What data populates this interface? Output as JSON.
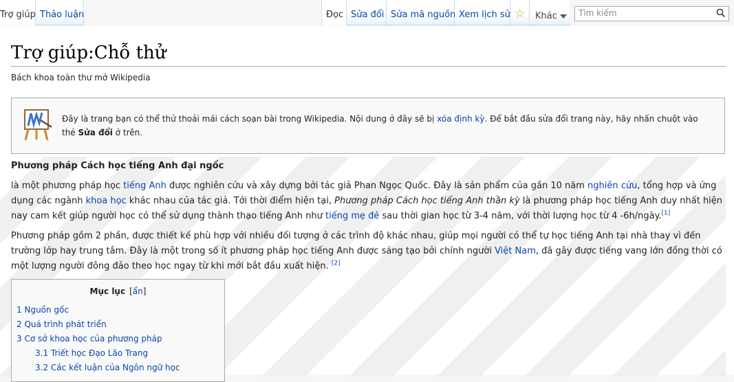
{
  "tabs": {
    "help": "Trợ giúp",
    "talk": "Thảo luận",
    "read": "Đọc",
    "edit": "Sửa đổi",
    "edit_source": "Sửa mã nguồn",
    "history": "Xem lịch sử",
    "more": "Khác"
  },
  "search": {
    "placeholder": "Tìm kiếm"
  },
  "page": {
    "title": "Trợ giúp:Chỗ thử",
    "subtitle": "Bách khoa toàn thư mở Wikipedia"
  },
  "notice": {
    "text_before": "Đây là trang bạn có thể thử thoải mái cách soạn bài trong Wikipedia. Nội dung ở đây sẽ bị ",
    "link": "xóa định kỳ",
    "text_after": ". Để bắt đầu sửa đổi trang này, hãy nhấn chuột vào thẻ ",
    "bold": "Sửa đổi",
    "text_end": " ở trên."
  },
  "article": {
    "heading": "Phương pháp Cách học tiếng Anh đại ngốc",
    "p1": {
      "t1": "là một phương pháp học ",
      "l1": "tiếng Anh",
      "t2": " được nghiên cứu và xây dựng bởi tác giả Phan Ngọc Quốc. Đây là sản phẩm của gần 10 năm ",
      "l2": "nghiên cứu",
      "t3": ", tổng hợp và ứng dụng các ngành ",
      "l3": "khoa học",
      "t4": " khác nhau của tác giả. Tới thời điểm hiện tại, ",
      "i1": "Phương pháp Cách học tiếng Anh thần kỳ",
      "t5": " là phương pháp học tiếng Anh duy nhất hiện nay cam kết giúp người học có thể sử dụng thành thạo tiếng Anh như ",
      "l4": "tiếng mẹ đẻ",
      "t6": " sau thời gian học từ 3-4 năm, với thời lượng học từ 4 -6h/ngày.",
      "ref": "[1]"
    },
    "p2": {
      "t1": "Phương pháp gồm 2 phần, được thiết kế phù hợp với nhiều đối tượng ở các trình độ khác nhau, giúp mọi người có thể tự học tiếng Anh tại nhà thay vì đến trường lớp hay trung tâm. Đây là một trong số ít phương pháp học tiếng Anh được sáng tạo bởi chính người ",
      "l1": "Việt Nam",
      "t2": ", đã gây được tiếng vang lớn đồng thời có một lượng người đông đảo theo học ngay từ khi mới bắt đầu xuất hiện.",
      "ref": "[2]"
    }
  },
  "toc": {
    "title": "Mục lục",
    "toggle_open": "[",
    "toggle": "ẩn",
    "toggle_close": "]",
    "items": [
      {
        "num": "1",
        "label": "Nguồn gốc"
      },
      {
        "num": "2",
        "label": "Quá trình phát triển"
      },
      {
        "num": "3",
        "label": "Cơ sở khoa học của phương pháp"
      },
      {
        "num": "3.1",
        "label": "Triết học Đạo Lão Trang"
      },
      {
        "num": "3.2",
        "label": "Các kết luận của Ngôn ngữ học"
      }
    ]
  },
  "colors": {
    "link": "#0645ad",
    "tab_border": "#a7d7f9",
    "star": "#8cc63f"
  }
}
